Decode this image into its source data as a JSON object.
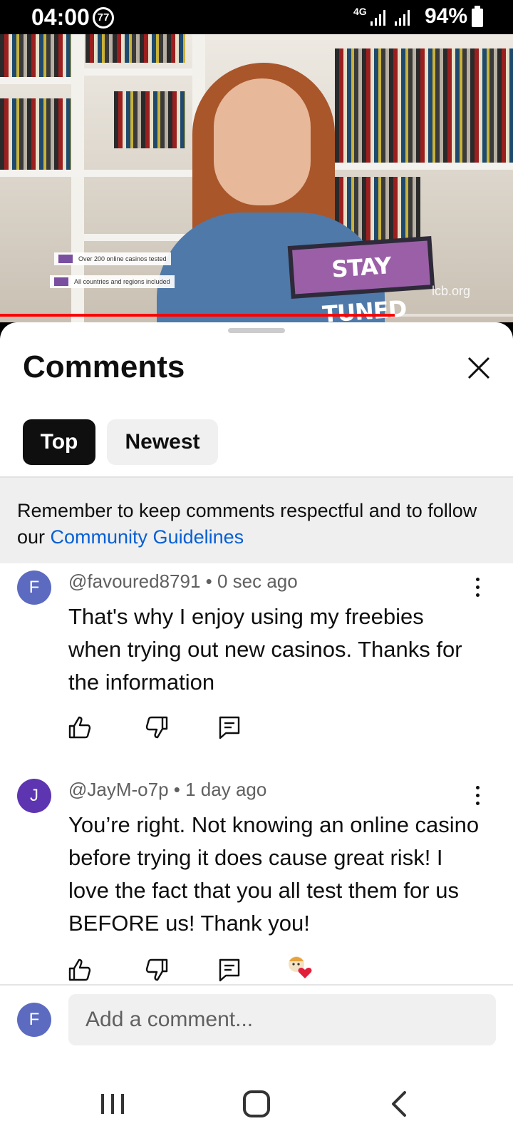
{
  "status_bar": {
    "time": "04:00",
    "app_icon_text": "77",
    "network": "4G",
    "battery": "94%"
  },
  "video": {
    "caption_1": "Over 200 online casinos tested",
    "caption_2": "All countries and regions included",
    "overlay_title": "STAY TUNED",
    "watermark": "lcb.org",
    "progress": 0.77
  },
  "comments_sheet": {
    "title": "Comments",
    "tabs": [
      {
        "label": "Top",
        "selected": true
      },
      {
        "label": "Newest",
        "selected": false
      }
    ],
    "notice_text": "Remember to keep comments respectful and to follow our ",
    "notice_link": "Community Guidelines",
    "comments": [
      {
        "avatar_letter": "F",
        "avatar_color": "#5c6bc0",
        "author": "@favoured8791",
        "age": "0 sec ago",
        "text": "That's why I enjoy using my freebies when trying out new casinos. Thanks for the information"
      },
      {
        "avatar_letter": "J",
        "avatar_color": "#5e35b1",
        "author": "@JayM-o7p",
        "age": "1 day ago",
        "text": "You’re right. Not knowing an online casino before trying it does cause great risk! I love the fact that you all test them for us BEFORE us! Thank you!",
        "creator_heart": true
      }
    ],
    "meta_separator": " • ",
    "input": {
      "avatar_letter": "F",
      "avatar_color": "#5c6bc0",
      "placeholder": "Add a comment..."
    }
  },
  "colors": {
    "accent_link": "#065fd4",
    "progress": "#ff0000",
    "chip_selected": "#0f0f0f"
  },
  "icons": [
    "close-icon",
    "like-icon",
    "dislike-icon",
    "reply-icon",
    "more-vert-icon",
    "recent-apps-icon",
    "home-icon",
    "back-icon"
  ]
}
